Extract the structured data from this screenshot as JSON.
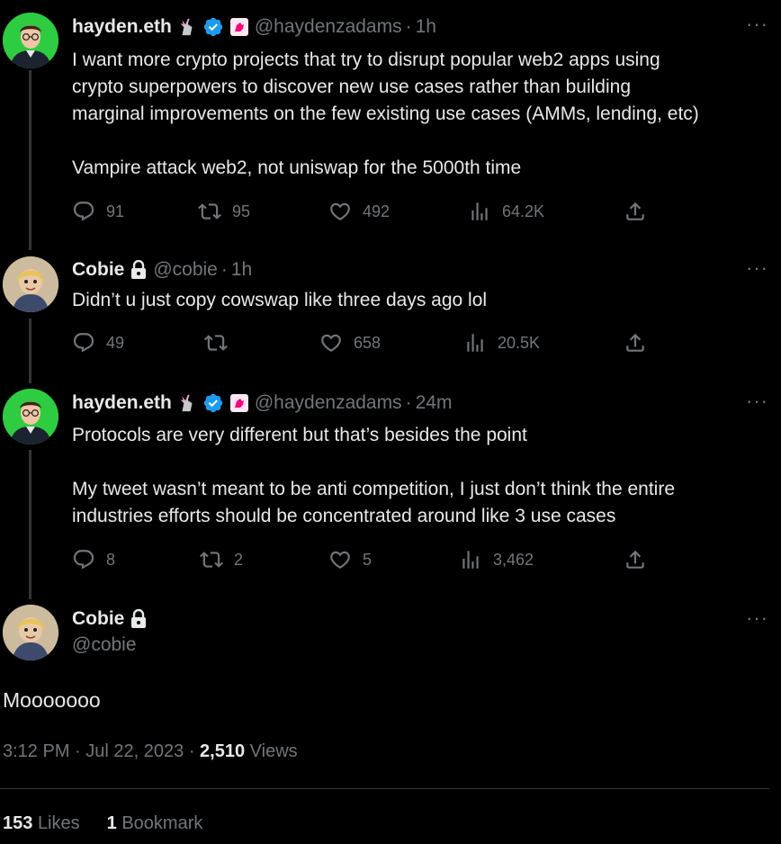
{
  "tweets": [
    {
      "name": "hayden.eth",
      "handle": "@haydenzadams",
      "time": "1h",
      "lines": [
        "I want more crypto projects that try to disrupt popular web2 apps using",
        "crypto superpowers to discover new use cases rather than building",
        "marginal improvements on the few existing use cases (AMMs, lending, etc)",
        "",
        "Vampire attack web2, not uniswap for the 5000th time"
      ],
      "replies": "91",
      "retweets": "95",
      "likes": "492",
      "views": "64.2K"
    },
    {
      "name": "Cobie",
      "handle": "@cobie",
      "time": "1h",
      "lines": [
        "Didn’t u just copy cowswap like three days ago lol"
      ],
      "replies": "49",
      "retweets": "",
      "likes": "658",
      "views": "20.5K"
    },
    {
      "name": "hayden.eth",
      "handle": "@haydenzadams",
      "time": "24m",
      "lines": [
        "Protocols are very different but that’s besides the point",
        "",
        "My tweet wasn’t meant to be anti competition, I just don’t think the entire",
        "industries efforts should be concentrated around like 3 use cases"
      ],
      "replies": "8",
      "retweets": "2",
      "likes": "5",
      "views": "3,462"
    }
  ],
  "main_tweet": {
    "name": "Cobie",
    "handle": "@cobie",
    "text": "Mooooooo",
    "time": "3:12 PM",
    "date": "Jul 22, 2023",
    "views_count": "2,510",
    "views_label": "Views",
    "likes_count": "153",
    "likes_label": "Likes",
    "bookmarks_count": "1",
    "bookmarks_label": "Bookmark"
  },
  "colors": {
    "background": "#000000",
    "text": "#e7e9ea",
    "muted": "#71767b",
    "verified": "#1d9bf0"
  },
  "icons": [
    "reply-icon",
    "retweet-icon",
    "like-icon",
    "views-icon",
    "share-icon",
    "verified-icon",
    "lock-icon",
    "unicorn-icon",
    "more-icon"
  ]
}
